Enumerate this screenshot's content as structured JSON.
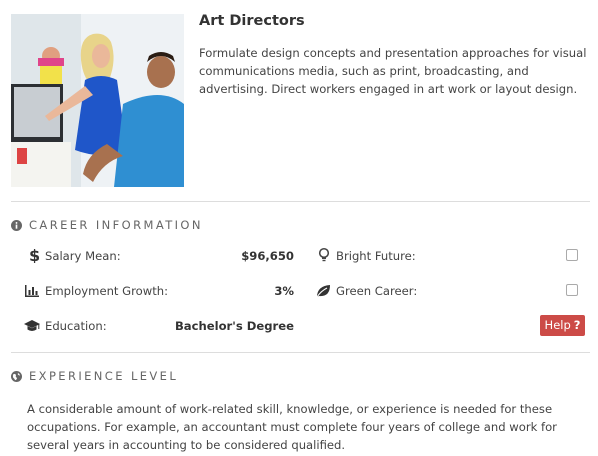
{
  "occupation": {
    "title": "Art Directors",
    "description": "Formulate design concepts and presentation approaches for visual communications media, such as print, broadcasting, and advertising. Direct workers engaged in art work or layout design."
  },
  "career_info": {
    "heading": "CAREER INFORMATION",
    "salary_label": "Salary Mean:",
    "salary_value": "$96,650",
    "growth_label": "Employment Growth:",
    "growth_value": "3%",
    "education_label": "Education:",
    "education_value": "Bachelor's Degree",
    "bright_future_label": "Bright Future:",
    "bright_future_checked": false,
    "green_career_label": "Green Career:",
    "green_career_checked": false,
    "help_label": "Help",
    "help_glyph": "?"
  },
  "experience": {
    "heading": "EXPERIENCE LEVEL",
    "text": "A considerable amount of work-related skill, knowledge, or experience is needed for these occupations. For example, an accountant must complete four years of college and work for several years in accounting to be considered qualified."
  },
  "colors": {
    "help_button": "#cc4b47",
    "divider": "#dddddd",
    "heading_gray": "#666666"
  },
  "icons": {
    "career_heading": "info-circle-icon",
    "experience_heading": "globe-icon",
    "salary": "dollar-icon",
    "growth": "bar-chart-icon",
    "education": "graduation-cap-icon",
    "bright_future": "lightbulb-icon",
    "green_career": "leaf-icon"
  }
}
